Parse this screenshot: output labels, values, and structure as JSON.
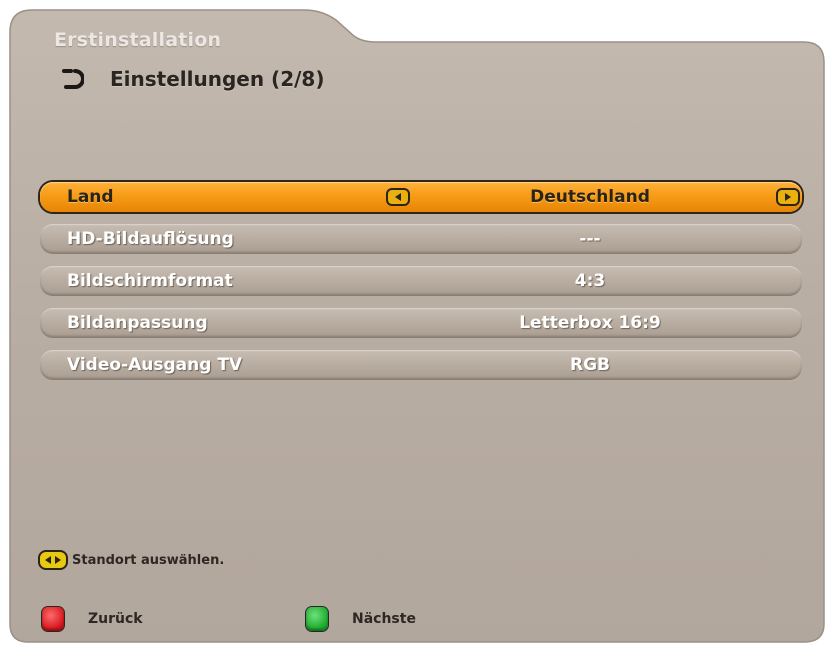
{
  "screen": {
    "tab_title": "Erstinstallation",
    "header_title": "Einstellungen (2/8)"
  },
  "settings": [
    {
      "label": "Land",
      "value": "Deutschland",
      "selected": true
    },
    {
      "label": "HD-Bildauflösung",
      "value": "---",
      "selected": false
    },
    {
      "label": "Bildschirmformat",
      "value": "4:3",
      "selected": false
    },
    {
      "label": "Bildanpassung",
      "value": "Letterbox 16:9",
      "selected": false
    },
    {
      "label": "Video-Ausgang TV",
      "value": "RGB",
      "selected": false
    }
  ],
  "hint": {
    "text": "Standort auswählen."
  },
  "footer": {
    "back_label": "Zurück",
    "next_label": "Nächste"
  },
  "colors": {
    "panel": "#b9aea4",
    "highlight": "#f59a14",
    "red_key": "#d4141c",
    "green_key": "#17a82b",
    "yellow_key": "#e7c90f"
  }
}
